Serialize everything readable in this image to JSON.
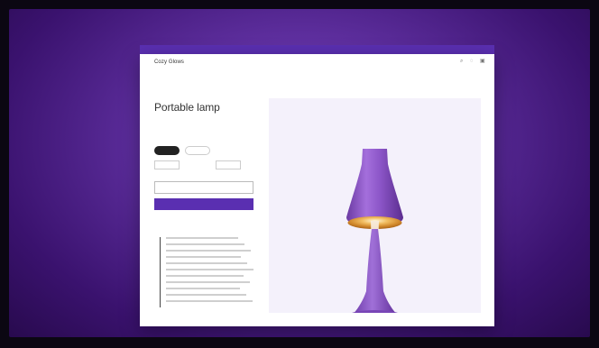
{
  "colors": {
    "background_top": "#2a0a4d",
    "background_glow": "#a77ae6",
    "accent": "#5a2fb1",
    "lamp_main": "#8b55c7",
    "lamp_inner": "#d28a2d"
  },
  "promo_bar": {
    "text": ""
  },
  "nav": {
    "brand": "Cozy Glows",
    "links": [
      "",
      "",
      ""
    ],
    "icons": [
      "search-icon",
      "user-icon",
      "cart-icon"
    ]
  },
  "product": {
    "breadcrumb": "",
    "title": "Portable lamp",
    "price": "",
    "badge": "",
    "color_label": "",
    "colors": [
      "",
      "",
      ""
    ],
    "size_options": [
      "",
      "",
      ""
    ]
  },
  "actions": {
    "secondary_label": "",
    "primary_label": ""
  },
  "tabs": [
    "",
    ""
  ],
  "description_lines": 11
}
